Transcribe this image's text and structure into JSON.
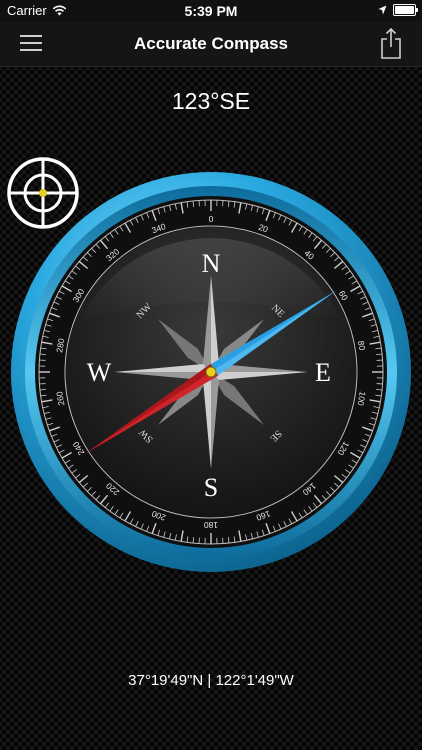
{
  "status_bar": {
    "carrier": "Carrier",
    "time": "5:39 PM",
    "icons": [
      "wifi-icon",
      "location-arrow-icon",
      "battery-icon"
    ]
  },
  "nav": {
    "title": "Accurate Compass",
    "menu_icon": "hamburger-menu-icon",
    "share_icon": "share-icon"
  },
  "compass": {
    "heading_text": "123°SE",
    "heading_degrees": 123,
    "cardinals": {
      "n": "N",
      "e": "E",
      "s": "S",
      "w": "W"
    },
    "intercardinals": {
      "ne": "NE",
      "se": "SE",
      "sw": "SW",
      "nw": "NW"
    },
    "degree_labels": [
      "0",
      "20",
      "40",
      "60",
      "80",
      "100",
      "120",
      "140",
      "160",
      "180",
      "200",
      "220",
      "240",
      "260",
      "280",
      "300",
      "320",
      "340"
    ],
    "colors": {
      "bezel": "#29a9e0",
      "needle_north": "#2b9fe6",
      "needle_south": "#d1232a",
      "dial": "#1b1b1b",
      "target_dot": "#e8d020"
    }
  },
  "location": {
    "coordinates": "37°19'49\"N | 122°1'49\"W"
  }
}
